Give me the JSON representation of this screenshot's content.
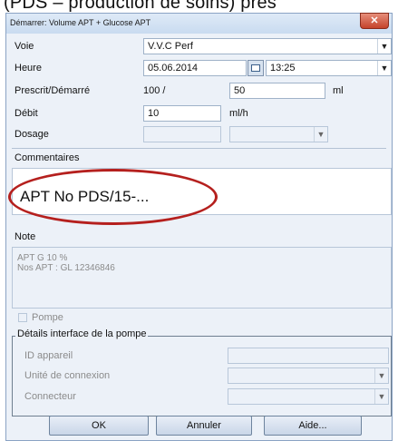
{
  "caption": "(PDS – production de soins) prés",
  "window": {
    "title": "Démarrer: Volume APT + Glucose APT",
    "close_glyph": "✕"
  },
  "fields": {
    "voie": {
      "label": "Voie",
      "value": "V.V.C Perf"
    },
    "heure": {
      "label": "Heure",
      "date": "05.06.2014",
      "time": "13:25"
    },
    "prescrit": {
      "label": "Prescrit/Démarré",
      "prescribed": "100 /",
      "started": "50",
      "unit": "ml"
    },
    "debit": {
      "label": "Débit",
      "value": "10",
      "unit": "ml/h"
    },
    "dosage": {
      "label": "Dosage"
    }
  },
  "commentaires": {
    "label": "Commentaires",
    "value": "APT No PDS/15-..."
  },
  "note": {
    "label": "Note",
    "lines": [
      "APT G  10 %",
      "Nos APT : GL 12346846"
    ]
  },
  "pompe": {
    "label": "Pompe",
    "checked": false
  },
  "pump_details": {
    "legend": "Détails interface de la pompe",
    "id_label": "ID appareil",
    "unit_label": "Unité de connexion",
    "connector_label": "Connecteur"
  },
  "buttons": {
    "ok": "OK",
    "cancel": "Annuler",
    "help": "Aide..."
  },
  "icons": {
    "dropdown": "chevron-down-icon",
    "calendar": "calendar-icon"
  },
  "colors": {
    "highlight_ellipse": "#b5201e",
    "dialog_bg": "#ecf1f8"
  }
}
